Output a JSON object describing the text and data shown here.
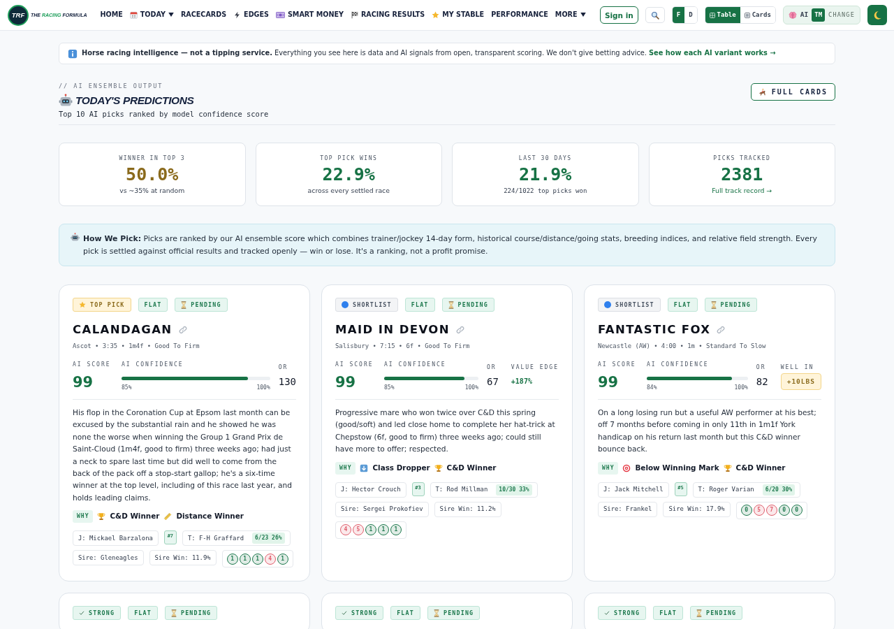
{
  "navbar": {
    "logo": "TRF",
    "brand": {
      "prefix": "THE",
      "highlight": "RACING",
      "suffix": "FORMULA"
    },
    "links": [
      {
        "kind": "plain",
        "label": "HOME",
        "dropdown": false
      },
      {
        "kind": "today",
        "label": "TODAY",
        "dropdown": true
      },
      {
        "kind": "plain",
        "label": "RACECARDS",
        "dropdown": false
      },
      {
        "kind": "edges",
        "label": "EDGES",
        "dropdown": false
      },
      {
        "kind": "money",
        "label": "SMART MONEY",
        "dropdown": false
      },
      {
        "kind": "results",
        "label": "RACING RESULTS",
        "dropdown": false
      },
      {
        "kind": "stable",
        "label": "MY STABLE",
        "dropdown": false
      },
      {
        "kind": "plain",
        "label": "PERFORMANCE",
        "dropdown": false
      },
      {
        "kind": "plain",
        "label": "MORE",
        "dropdown": true
      }
    ],
    "sign_in": "Sign in",
    "font_toggle": [
      {
        "label": "F",
        "selected": true
      },
      {
        "label": "D",
        "selected": false
      }
    ],
    "view_toggle": [
      {
        "kind": "table",
        "label": "Table",
        "selected": true
      },
      {
        "kind": "cards",
        "label": "Cards",
        "selected": false
      }
    ],
    "model": {
      "label": "AI",
      "code": "TM",
      "action": "CHANGE"
    }
  },
  "notice": {
    "text": "**Horse racing intelligence — not a tipping service.** Everything you see here is data and AI signals from open, transparent scoring. We don't give betting advice.",
    "link": "See how each AI variant works →"
  },
  "header": {
    "eyebrow": "// AI ENSEMBLE OUTPUT",
    "title": "TODAY'S PREDICTIONS",
    "subtitle": "Top 10 AI picks ranked by model confidence score",
    "button": "FULL CARDS"
  },
  "stats": [
    {
      "label": "WINNER IN TOP 3",
      "value": "50.0%",
      "color": "#8a6a1c",
      "note": {
        "kind": "plain",
        "text": "vs ~35% at random"
      }
    },
    {
      "label": "TOP PICK WINS",
      "value": "22.9%",
      "color": "#177245",
      "note": {
        "kind": "plain",
        "text": "across every settled race"
      }
    },
    {
      "label": "LAST 30 DAYS",
      "value": "21.9%",
      "color": "#177245",
      "note": {
        "kind": "figures",
        "text": "224/1022 top picks won"
      }
    },
    {
      "label": "PICKS TRACKED",
      "value": "2381",
      "color": "#177245",
      "note": {
        "kind": "link",
        "text": "Full track record →"
      }
    }
  ],
  "method": {
    "text": "**How We Pick:** Picks are ranked by our AI ensemble score which combines trainer/jockey 14-day form, historical course/distance/going stats, breeding indices, and relative field strength. Every pick is settled against official results and tracked openly — win or lose. It's a ranking, not a profit promise."
  },
  "picks": [
    {
      "tier": {
        "kind": "top",
        "label": "TOP PICK"
      },
      "race_type": "FLAT",
      "status": {
        "kind": "pending",
        "label": "PENDING"
      },
      "horse": "CALANDAGAN",
      "meta": "Ascot • 3:35 • 1m4f • Good To Firm",
      "score_label": "AI SCORE",
      "score": "99",
      "confidence_label": "AI CONFIDENCE",
      "level": 0.85,
      "confidence_low": "85%",
      "confidence_high": "100%",
      "metrics": [
        {
          "kind": "rating",
          "label": "OR",
          "value": "130"
        }
      ],
      "comment": "His flop in the Coronation Cup at Epsom last month can be excused by the substantial rain and he showed he was none the worse when winning the Group 1 Grand Prix de Saint-Cloud (1m4f, good to firm) three weeks ago; had just a neck to spare last time but did well to come from the back of the pack off a stop-start gallop; he's a six-time winner at the top level, including of this race last year, and holds leading claims.",
      "why_label": "WHY",
      "reasons": [
        {
          "kind": "course",
          "label": "C&D Winner"
        },
        {
          "kind": "distance",
          "label": "Distance Winner"
        }
      ],
      "jockey": "J: Mickael Barzalona",
      "draw": "#7",
      "trainer": "T: F-H Graffard",
      "trainer_form": "6/23 26%",
      "sire": "Sire: Gleneagles",
      "sire_win": "Sire Win: 11.9%",
      "form": [
        {
          "figure": "1",
          "color": "#1f7a4f"
        },
        {
          "figure": "1",
          "color": "#1f7a4f"
        },
        {
          "figure": "1",
          "color": "#1f7a4f"
        },
        {
          "figure": "4",
          "color": "#e0606e"
        },
        {
          "figure": "1",
          "color": "#1f7a4f"
        }
      ]
    },
    {
      "tier": {
        "kind": "shortlist",
        "label": "SHORTLIST"
      },
      "race_type": "FLAT",
      "status": {
        "kind": "pending",
        "label": "PENDING"
      },
      "horse": "MAID IN DEVON",
      "meta": "Salisbury • 7:15 • 6f • Good To Firm",
      "score_label": "AI SCORE",
      "score": "99",
      "confidence_label": "AI CONFIDENCE",
      "level": 0.85,
      "confidence_low": "85%",
      "confidence_high": "100%",
      "metrics": [
        {
          "kind": "rating",
          "label": "OR",
          "value": "67"
        },
        {
          "kind": "edge",
          "label": "VALUE EDGE",
          "value": "+187%"
        }
      ],
      "comment": "Progressive mare who won twice over C&D this spring (good/soft) and led close home to complete her hat-trick at Chepstow (6f, good to firm) three weeks ago; could still have more to offer; respected.",
      "why_label": "WHY",
      "reasons": [
        {
          "kind": "class",
          "label": "Class Dropper"
        },
        {
          "kind": "course",
          "label": "C&D Winner"
        }
      ],
      "jockey": "J: Hector Crouch",
      "draw": "#3",
      "trainer": "T: Rod Millman",
      "trainer_form": "10/30 33%",
      "sire": "Sire: Sergei Prokofiev",
      "sire_win": "Sire Win: 11.2%",
      "form": [
        {
          "figure": "4",
          "color": "#e0606e"
        },
        {
          "figure": "5",
          "color": "#e0606e"
        },
        {
          "figure": "1",
          "color": "#1f7a4f"
        },
        {
          "figure": "1",
          "color": "#1f7a4f"
        },
        {
          "figure": "1",
          "color": "#1f7a4f"
        }
      ]
    },
    {
      "tier": {
        "kind": "shortlist",
        "label": "SHORTLIST"
      },
      "race_type": "FLAT",
      "status": {
        "kind": "pending",
        "label": "PENDING"
      },
      "horse": "FANTASTIC FOX",
      "meta": "Newcastle (AW) • 4:00 • 1m • Standard To Slow",
      "score_label": "AI SCORE",
      "score": "99",
      "confidence_label": "AI CONFIDENCE",
      "level": 0.84,
      "confidence_low": "84%",
      "confidence_high": "100%",
      "metrics": [
        {
          "kind": "rating",
          "label": "OR",
          "value": "82"
        },
        {
          "kind": "well_in",
          "label": "WELL IN",
          "value": "+10LBS"
        }
      ],
      "comment": "On a long losing run but a useful AW performer at his best; off 7 months before coming in only 11th in 1m1f York handicap on his return last month but this C&D winner bounce back.",
      "why_label": "WHY",
      "reasons": [
        {
          "kind": "mark",
          "label": "Below Winning Mark"
        },
        {
          "kind": "course",
          "label": "C&D Winner"
        }
      ],
      "jockey": "J: Jack Mitchell",
      "draw": "#5",
      "trainer": "T: Roger Varian",
      "trainer_form": "6/20 30%",
      "sire": "Sire: Frankel",
      "sire_win": "Sire Win: 17.9%",
      "form": [
        {
          "figure": "0",
          "color": "#1f7a4f"
        },
        {
          "figure": "5",
          "color": "#e0606e"
        },
        {
          "figure": "7",
          "color": "#e0606e"
        },
        {
          "figure": "0",
          "color": "#1f7a4f"
        },
        {
          "figure": "0",
          "color": "#1f7a4f"
        }
      ]
    },
    {
      "tier": {
        "kind": "strong",
        "label": "STRONG"
      },
      "race_type": "FLAT",
      "status": {
        "kind": "pending",
        "label": "PENDING"
      }
    },
    {
      "tier": {
        "kind": "strong",
        "label": "STRONG"
      },
      "race_type": "FLAT",
      "status": {
        "kind": "pending",
        "label": "PENDING"
      }
    },
    {
      "tier": {
        "kind": "strong",
        "label": "STRONG"
      },
      "race_type": "FLAT",
      "status": {
        "kind": "pending",
        "label": "PENDING"
      }
    }
  ]
}
